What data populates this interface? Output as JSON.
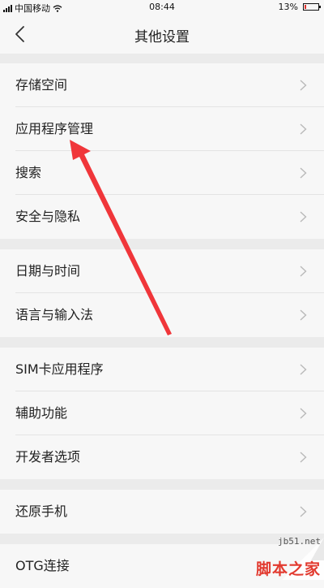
{
  "status_bar": {
    "carrier": "中国移动",
    "time": "08:44",
    "battery": "13%",
    "battery_level": 0.13
  },
  "header": {
    "title": "其他设置"
  },
  "groups": [
    {
      "items": [
        "存储空间",
        "应用程序管理",
        "搜索",
        "安全与隐私"
      ]
    },
    {
      "items": [
        "日期与时间",
        "语言与输入法"
      ]
    },
    {
      "items": [
        "SIM卡应用程序",
        "辅助功能",
        "开发者选项"
      ]
    },
    {
      "items": [
        "还原手机"
      ]
    },
    {
      "items": [
        "OTG连接"
      ]
    }
  ],
  "watermark": {
    "url": "jb51.net",
    "name": "脚本之家"
  },
  "colors": {
    "annotation_arrow": "#f0363a",
    "battery_low": "#e0312d"
  }
}
